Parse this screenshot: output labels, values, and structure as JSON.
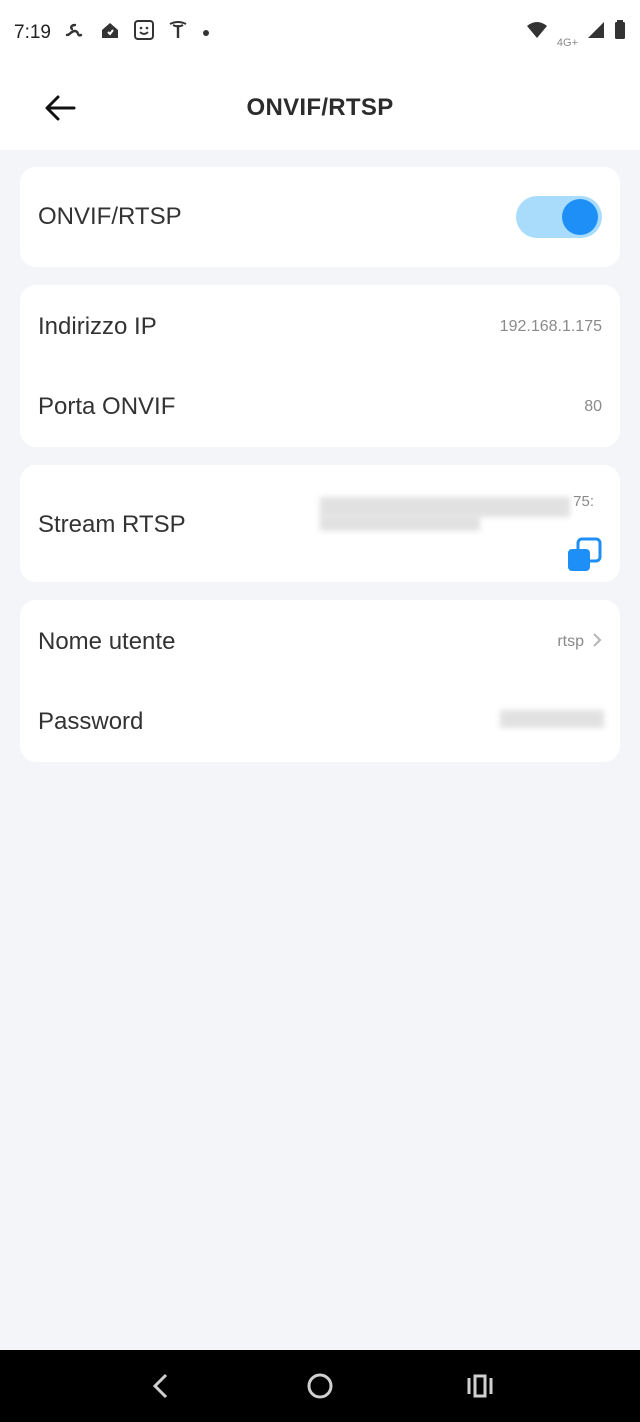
{
  "status_bar": {
    "time": "7:19",
    "network_label": "4G+",
    "left_icons": [
      "app-s-icon",
      "app-home-icon",
      "app-face-icon",
      "tesla-icon",
      "dot-icon"
    ],
    "right_icons": [
      "wifi-icon",
      "signal-icon",
      "battery-icon"
    ]
  },
  "header": {
    "title": "ONVIF/RTSP",
    "back_icon": "arrow-left-icon"
  },
  "onvif_card": {
    "label": "ONVIF/RTSP",
    "enabled": true
  },
  "network_card": {
    "ip_label": "Indirizzo IP",
    "ip_value": "192.168.1.175",
    "port_label": "Porta ONVIF",
    "port_value": "80"
  },
  "stream_card": {
    "label": "Stream RTSP",
    "value_visible_fragment": "75:",
    "copy_icon": "copy-icon"
  },
  "credentials_card": {
    "username_label": "Nome utente",
    "username_value": "rtsp",
    "password_label": "Password"
  },
  "colors": {
    "accent": "#1e8ff7",
    "toggle_track": "#a9dcfb",
    "background": "#f4f5f9",
    "card": "#ffffff"
  }
}
